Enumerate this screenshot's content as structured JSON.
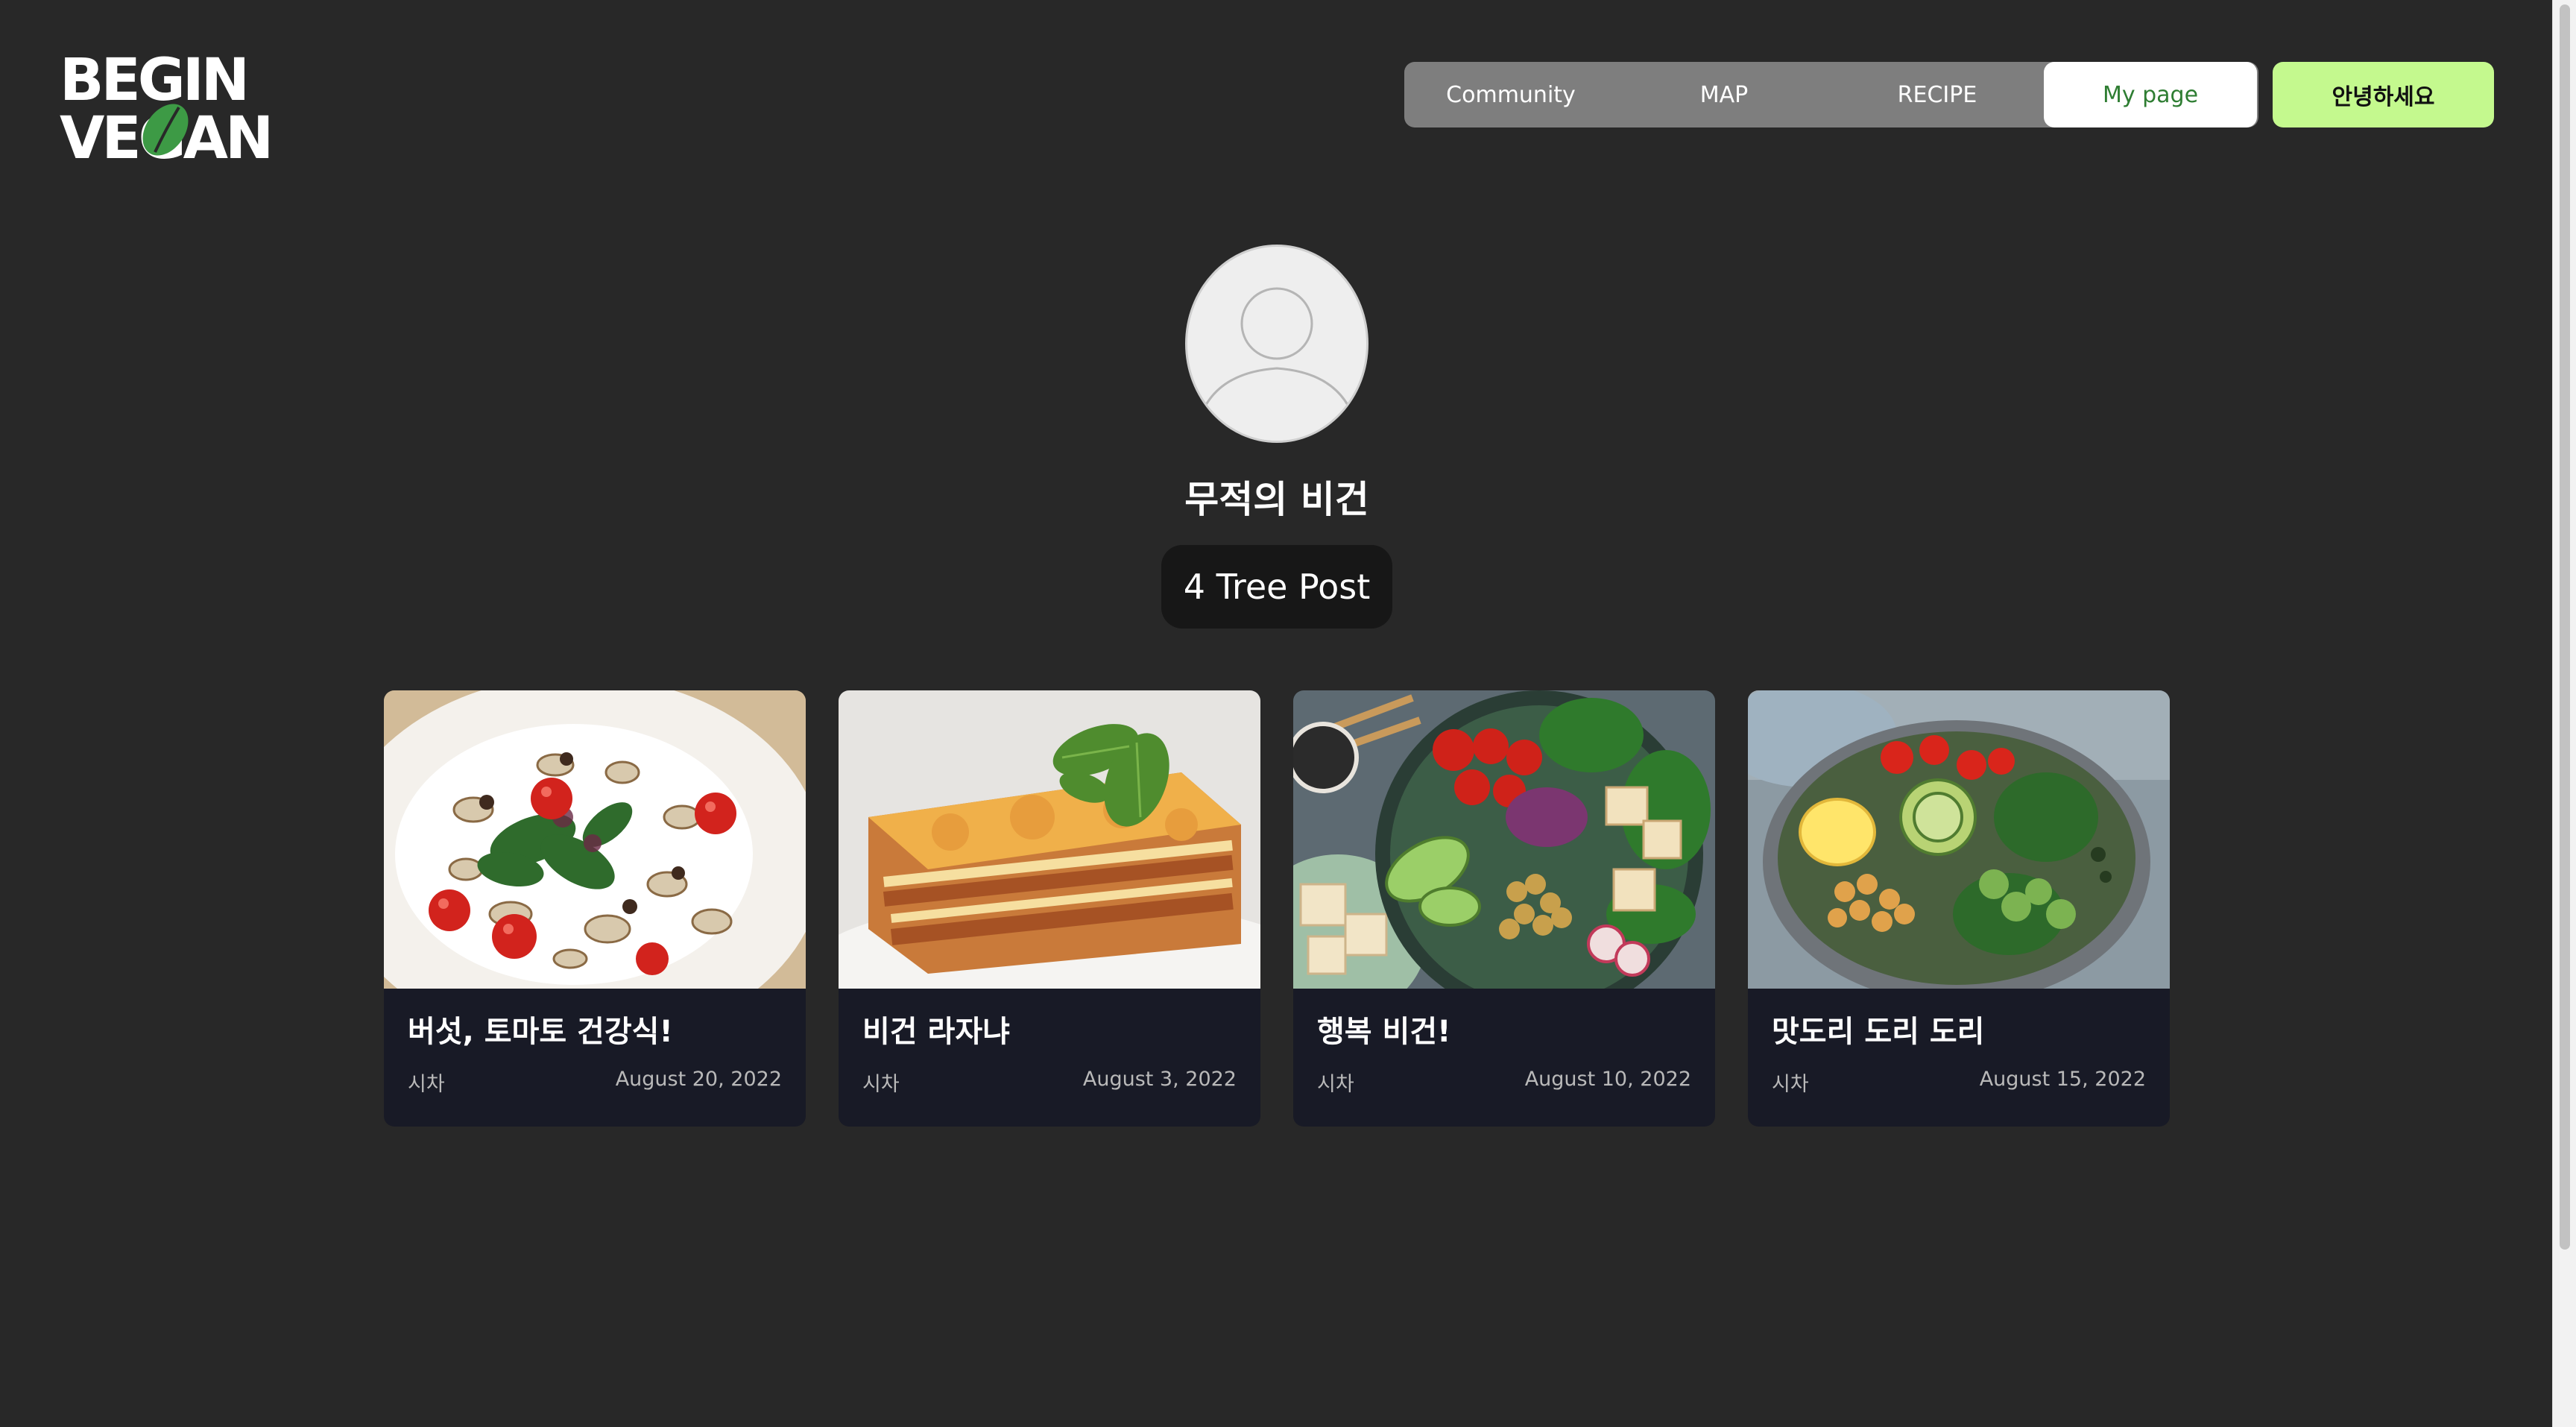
{
  "logo": {
    "line1": "BEGIN",
    "line2": "VEGAN"
  },
  "nav": {
    "items": [
      {
        "label": "Community"
      },
      {
        "label": "MAP"
      },
      {
        "label": "RECIPE"
      },
      {
        "label": "My page"
      }
    ],
    "active": "My page",
    "greeting_button": "안녕하세요"
  },
  "profile": {
    "username": "무적의 비건",
    "post_count": "4 Tree Post"
  },
  "posts": [
    {
      "title": "버섯, 토마토 건강식!",
      "author": "시차",
      "date": "August 20, 2022"
    },
    {
      "title": "비건 라자냐",
      "author": "시차",
      "date": "August 3, 2022"
    },
    {
      "title": "행복 비건!",
      "author": "시차",
      "date": "August 10, 2022"
    },
    {
      "title": "맛도리 도리 도리",
      "author": "시차",
      "date": "August 15, 2022"
    }
  ],
  "colors": {
    "background": "#282828",
    "nav_bg": "#7e7e7e",
    "active_text": "#2e7d32",
    "greeting_bg": "#c4f98e",
    "card_bg": "#181a26",
    "leaf": "#3d9a45"
  }
}
